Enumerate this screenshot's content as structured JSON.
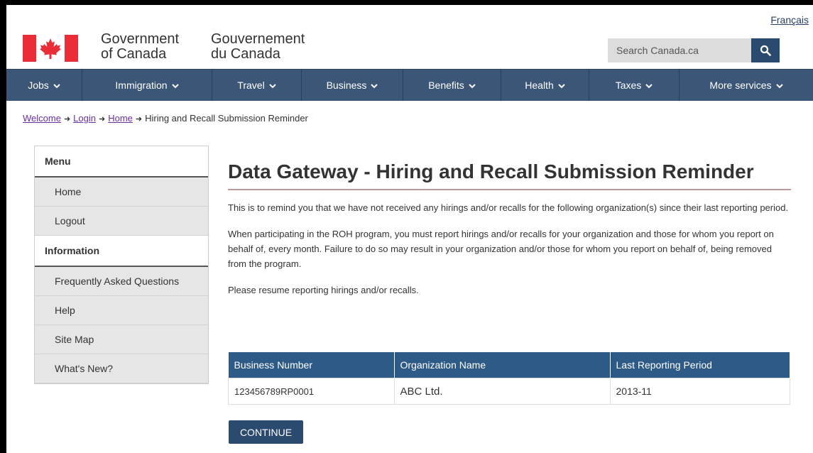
{
  "header": {
    "language_link": "Français",
    "government_en_line1": "Government",
    "government_en_line2": "of Canada",
    "government_fr_line1": "Gouvernement",
    "government_fr_line2": "du Canada",
    "search_placeholder": "Search Canada.ca"
  },
  "nav": {
    "items": [
      {
        "label": "Jobs"
      },
      {
        "label": "Immigration"
      },
      {
        "label": "Travel"
      },
      {
        "label": "Business"
      },
      {
        "label": "Benefits"
      },
      {
        "label": "Health"
      },
      {
        "label": "Taxes"
      },
      {
        "label": "More services"
      }
    ]
  },
  "breadcrumb": {
    "links": [
      "Welcome",
      "Login",
      "Home"
    ],
    "current": "Hiring and Recall Submission Reminder"
  },
  "sidebar": {
    "menu_heading": "Menu",
    "menu_items": [
      "Home",
      "Logout"
    ],
    "info_heading": "Information",
    "info_items": [
      "Frequently Asked Questions",
      "Help",
      "Site Map",
      "What's New?"
    ]
  },
  "main": {
    "title": "Data Gateway - Hiring and Recall Submission Reminder",
    "para1": "This is to remind you that we have not received any hirings and/or recalls for the following organization(s) since their last reporting period.",
    "para2": "When participating in the ROH program, you must report hirings and/or recalls for your organization and those for whom you report on behalf of, every month. Failure to do so may result in your organization and/or those for whom you report on behalf of, being removed from the program.",
    "para3": "Please resume reporting hirings and/or recalls."
  },
  "table": {
    "headers": [
      "Business Number",
      "Organization Name",
      "Last Reporting Period"
    ],
    "rows": [
      [
        "123456789RP0001",
        "ABC Ltd.",
        "2013-11"
      ]
    ]
  },
  "actions": {
    "continue_label": "CONTINUE"
  },
  "colors": {
    "nav_bg": "#3b5677",
    "table_header": "#2e5a88",
    "button": "#2b4a70",
    "flag_red": "#eb2d37"
  }
}
